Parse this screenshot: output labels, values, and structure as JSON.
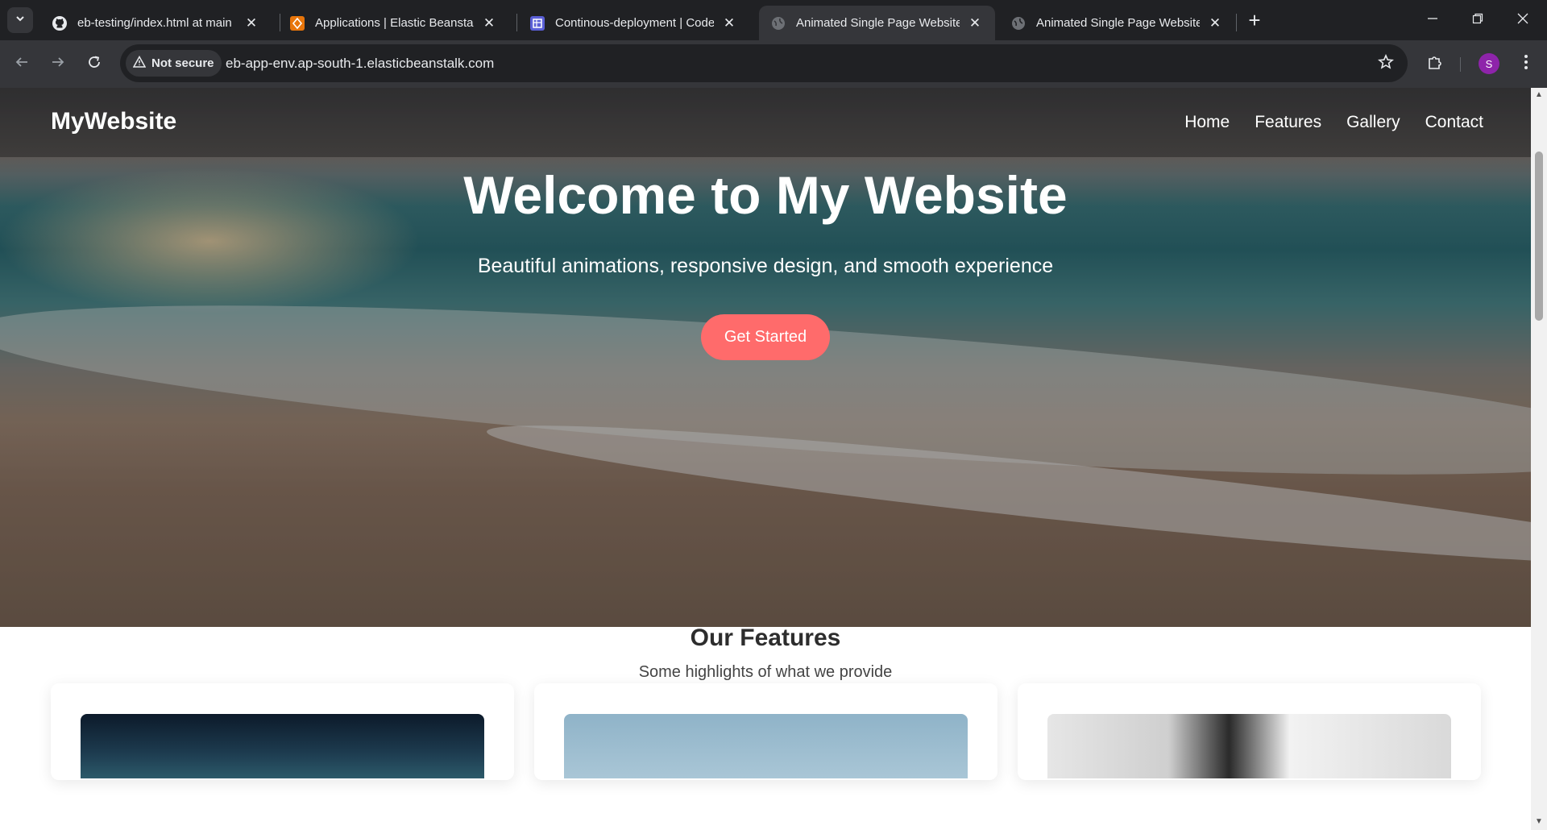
{
  "browser": {
    "tabs": [
      {
        "title": "eb-testing/index.html at main ·",
        "icon": "github-icon"
      },
      {
        "title": "Applications | Elastic Beanstalk |",
        "icon": "aws-beanstalk-icon"
      },
      {
        "title": "Continous-deployment | CodeP",
        "icon": "codepipeline-icon"
      },
      {
        "title": "Animated Single Page Website",
        "icon": "globe-icon",
        "active": true
      },
      {
        "title": "Animated Single Page Website",
        "icon": "globe-icon"
      }
    ],
    "security_label": "Not secure",
    "url": "eb-app-env.ap-south-1.elasticbeanstalk.com",
    "profile_initial": "S"
  },
  "site": {
    "brand": "MyWebsite",
    "nav": [
      "Home",
      "Features",
      "Gallery",
      "Contact"
    ],
    "hero": {
      "title": "Welcome to My Website",
      "subtitle": "Beautiful animations, responsive design, and smooth experience",
      "cta": "Get Started"
    },
    "features": {
      "title": "Our Features",
      "subtitle": "Some highlights of what we provide"
    }
  },
  "colors": {
    "accent": "#ff6b6b",
    "chrome_bg": "#202124",
    "toolbar_bg": "#35363a",
    "avatar": "#8e24aa"
  }
}
